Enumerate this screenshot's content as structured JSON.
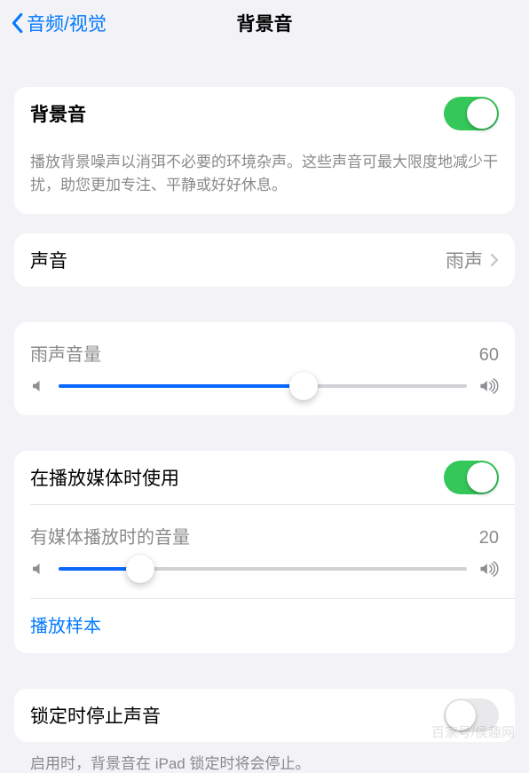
{
  "nav": {
    "back_label": "音频/视觉",
    "title": "背景音"
  },
  "bg_sounds": {
    "title": "背景音",
    "enabled": true,
    "description": "播放背景噪声以消弭不必要的环境杂声。这些声音可最大限度地减少干扰，助您更加专注、平静或好好休息。"
  },
  "sound_row": {
    "label": "声音",
    "value": "雨声"
  },
  "volume": {
    "label": "雨声音量",
    "value": 60
  },
  "media": {
    "use_label": "在播放媒体时使用",
    "enabled": true,
    "volume_label": "有媒体播放时的音量",
    "volume_value": 20,
    "sample_label": "播放样本"
  },
  "lock": {
    "label": "锁定时停止声音",
    "enabled": false,
    "note": "启用时，背景音在 iPad 锁定时将会停止。"
  },
  "watermark": "百家号/侯趣网",
  "colors": {
    "tint": "#007aff",
    "toggle_on": "#34c759"
  }
}
